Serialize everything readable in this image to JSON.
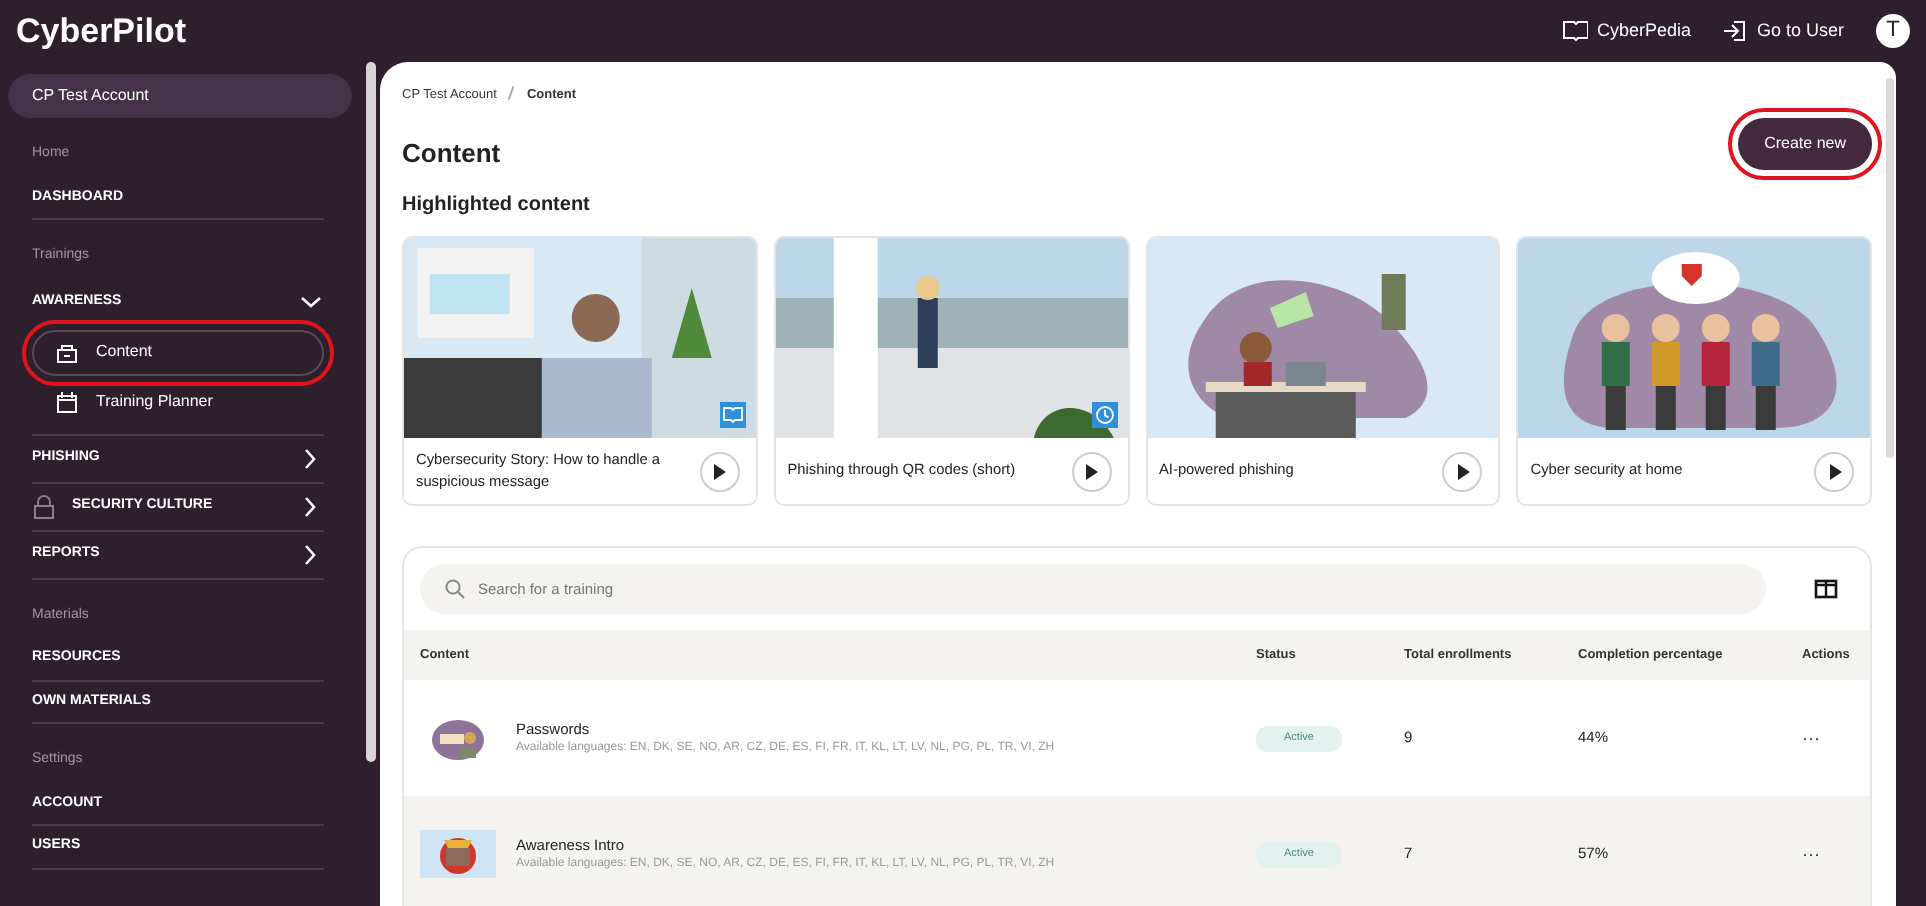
{
  "top_bar": {
    "logo": "CyberPilot",
    "links": [
      {
        "label": "CyberPedia",
        "kind": "book"
      },
      {
        "label": "Go to User",
        "kind": "enter"
      }
    ],
    "avatar": "T"
  },
  "sidebar": {
    "account": "CP Test Account",
    "sections": [
      {
        "heading": "Home",
        "items": [
          {
            "label": "DASHBOARD",
            "kind": "link"
          }
        ]
      },
      {
        "heading": "Trainings",
        "items": [
          {
            "label": "AWARENESS",
            "kind": "group",
            "expanded": true,
            "children": [
              {
                "label": "Content",
                "kind": "box",
                "selected": true,
                "highlighted": true
              },
              {
                "label": "Training Planner",
                "kind": "calendar",
                "selected": false,
                "highlighted": false
              }
            ]
          },
          {
            "label": "PHISHING",
            "kind": "group",
            "expanded": false
          },
          {
            "label": "SECURITY CULTURE",
            "kind": "group",
            "expanded": false,
            "locked": true
          },
          {
            "label": "REPORTS",
            "kind": "group",
            "expanded": false
          }
        ]
      },
      {
        "heading": "Materials",
        "items": [
          {
            "label": "RESOURCES",
            "kind": "link"
          },
          {
            "label": "OWN MATERIALS",
            "kind": "link"
          }
        ]
      },
      {
        "heading": "Settings",
        "items": [
          {
            "label": "ACCOUNT",
            "kind": "link"
          },
          {
            "label": "USERS",
            "kind": "link"
          }
        ]
      }
    ]
  },
  "breadcrumb": [
    "CP Test Account",
    "Content"
  ],
  "title": "Content",
  "create_button": {
    "label": "Create new",
    "highlighted": true
  },
  "highlighted": {
    "heading": "Highlighted content",
    "cards": [
      {
        "title": "Cybersecurity Story: How to handle a suspicious message",
        "kind": "reading"
      },
      {
        "title": "Phishing through QR codes (short)",
        "kind": "timed"
      },
      {
        "title": "AI-powered phishing",
        "kind": "plain"
      },
      {
        "title": "Cyber security at home",
        "kind": "plain"
      }
    ]
  },
  "search": {
    "placeholder": "Search for a training"
  },
  "table": {
    "columns": [
      "Content",
      "Status",
      "Total enrollments",
      "Completion percentage",
      "Actions"
    ],
    "rows": [
      {
        "name": "Passwords",
        "languages": "Available languages: EN, DK, SE, NO, AR, CZ, DE, ES, FI, FR, IT, KL, LT, LV, NL, PG, PL, TR, VI, ZH",
        "status": "Active",
        "enrollments": "9",
        "completion": "44%",
        "actions": "···"
      },
      {
        "name": "Awareness Intro",
        "languages": "Available languages: EN, DK, SE, NO, AR, CZ, DE, ES, FI, FR, IT, KL, LT, LV, NL, PG, PL, TR, VI, ZH",
        "status": "Active",
        "enrollments": "7",
        "completion": "57%",
        "actions": "···"
      }
    ]
  }
}
